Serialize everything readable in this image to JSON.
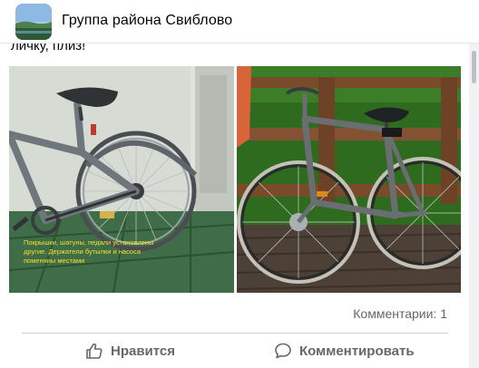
{
  "header": {
    "group_name": "Группа района Свиблово",
    "avatar": "group-avatar-landscape"
  },
  "post": {
    "text": "личку, плиз!",
    "photo_left_caption": "Покрышки, шатуны, педали установлены другие. Держатели бутылки и насоса поменяны местами",
    "photos": [
      "bicycle-photo-indoor",
      "bicycle-photo-outdoor"
    ]
  },
  "stats": {
    "comments": "Комментарии: 1"
  },
  "actions": {
    "like_label": "Нравится",
    "comment_label": "Комментировать",
    "like_icon": "thumbs-up-icon",
    "comment_icon": "speech-bubble-icon"
  },
  "colors": {
    "text_primary": "#050505",
    "text_secondary": "#65676b",
    "divider": "#ced0d4",
    "caption_yellow": "#f4e02c"
  }
}
